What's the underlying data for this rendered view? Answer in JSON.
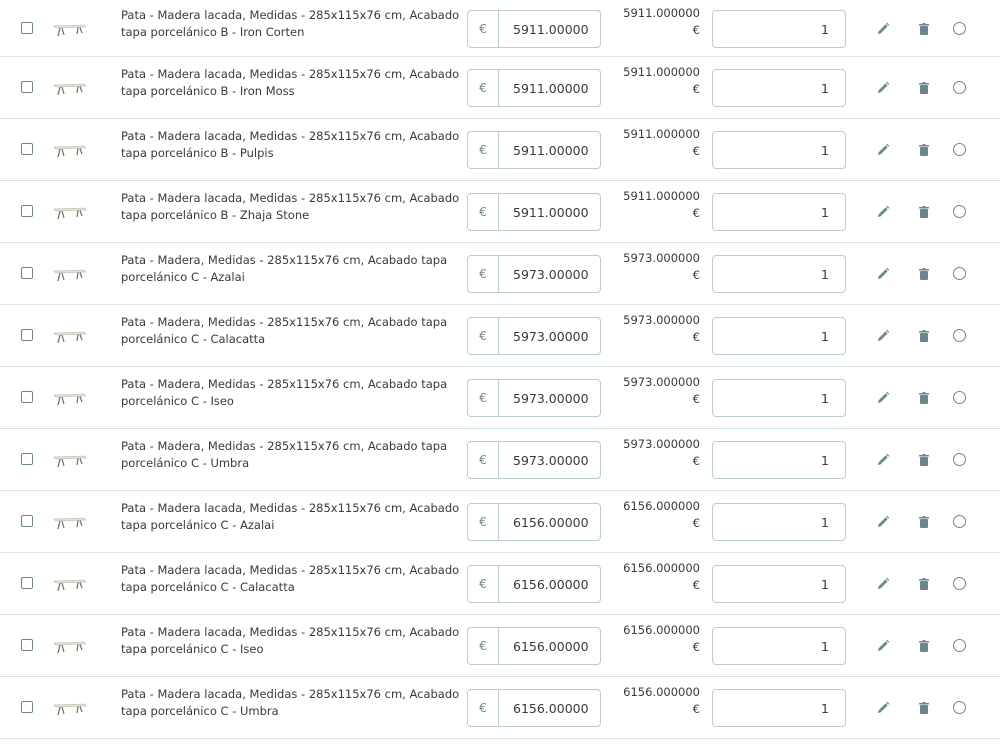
{
  "rows": [
    {
      "name": "Pata - Madera lacada, Medidas - 285x115x76 cm, Acabado tapa porcelánico B - Iron Corten",
      "currency": "€",
      "price": "5911.00000",
      "total": "5911.000000",
      "total_currency": "€",
      "qty": "1"
    },
    {
      "name": "Pata - Madera lacada, Medidas - 285x115x76 cm, Acabado tapa porcelánico B - Iron Moss",
      "currency": "€",
      "price": "5911.00000",
      "total": "5911.000000",
      "total_currency": "€",
      "qty": "1"
    },
    {
      "name": "Pata - Madera lacada, Medidas - 285x115x76 cm, Acabado tapa porcelánico B - Pulpis",
      "currency": "€",
      "price": "5911.00000",
      "total": "5911.000000",
      "total_currency": "€",
      "qty": "1"
    },
    {
      "name": "Pata - Madera lacada, Medidas - 285x115x76 cm, Acabado tapa porcelánico B - Zhaja Stone",
      "currency": "€",
      "price": "5911.00000",
      "total": "5911.000000",
      "total_currency": "€",
      "qty": "1"
    },
    {
      "name": "Pata - Madera, Medidas - 285x115x76 cm, Acabado tapa porcelánico C - Azalai",
      "currency": "€",
      "price": "5973.00000",
      "total": "5973.000000",
      "total_currency": "€",
      "qty": "1"
    },
    {
      "name": "Pata - Madera, Medidas - 285x115x76 cm, Acabado tapa porcelánico C - Calacatta",
      "currency": "€",
      "price": "5973.00000",
      "total": "5973.000000",
      "total_currency": "€",
      "qty": "1"
    },
    {
      "name": "Pata - Madera, Medidas - 285x115x76 cm, Acabado tapa porcelánico C - Iseo",
      "currency": "€",
      "price": "5973.00000",
      "total": "5973.000000",
      "total_currency": "€",
      "qty": "1"
    },
    {
      "name": "Pata - Madera, Medidas - 285x115x76 cm, Acabado tapa porcelánico C - Umbra",
      "currency": "€",
      "price": "5973.00000",
      "total": "5973.000000",
      "total_currency": "€",
      "qty": "1"
    },
    {
      "name": "Pata - Madera lacada, Medidas - 285x115x76 cm, Acabado tapa porcelánico C - Azalai",
      "currency": "€",
      "price": "6156.00000",
      "total": "6156.000000",
      "total_currency": "€",
      "qty": "1"
    },
    {
      "name": "Pata - Madera lacada, Medidas - 285x115x76 cm, Acabado tapa porcelánico C - Calacatta",
      "currency": "€",
      "price": "6156.00000",
      "total": "6156.000000",
      "total_currency": "€",
      "qty": "1"
    },
    {
      "name": "Pata - Madera lacada, Medidas - 285x115x76 cm, Acabado tapa porcelánico C - Iseo",
      "currency": "€",
      "price": "6156.00000",
      "total": "6156.000000",
      "total_currency": "€",
      "qty": "1"
    },
    {
      "name": "Pata - Madera lacada, Medidas - 285x115x76 cm, Acabado tapa porcelánico C - Umbra",
      "currency": "€",
      "price": "6156.00000",
      "total": "6156.000000",
      "total_currency": "€",
      "qty": "1"
    }
  ],
  "icons": {
    "edit": "pencil-icon",
    "delete": "trash-icon",
    "select": "radio-icon",
    "checkbox": "checkbox-icon",
    "thumbnail": "table-thumbnail"
  },
  "colors": {
    "border": "#d8e3e8",
    "input_border": "#bbcdd2",
    "icon": "#6c868e",
    "text": "#363a41"
  }
}
